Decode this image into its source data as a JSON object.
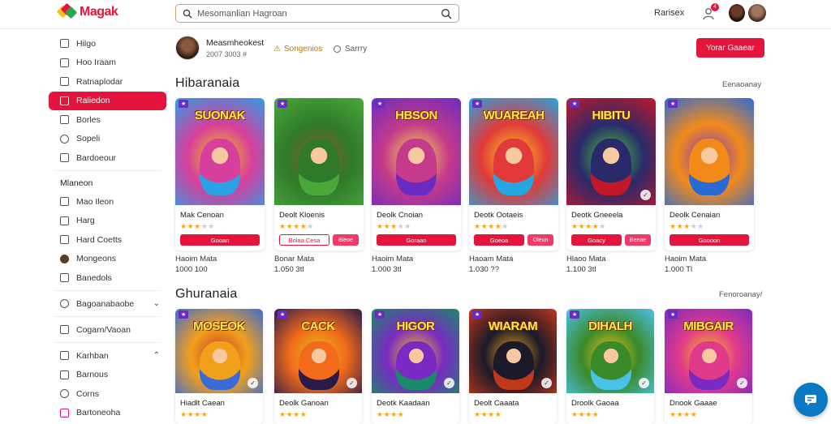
{
  "app": {
    "logo_text": "Magak"
  },
  "search": {
    "placeholder": "Mesomanlian Hagroan"
  },
  "header": {
    "right_label": "Rarisex",
    "notification_count": "4"
  },
  "profile": {
    "name": "Measmheokest",
    "sub": "2007 3003 #"
  },
  "badges": {
    "gold": "Songenios",
    "gray": "Sarrry"
  },
  "cta": {
    "label": "Yorar Gaaear"
  },
  "sidebar": {
    "items_top": [
      {
        "label": "Hilgo"
      },
      {
        "label": "Hoo Iraam"
      },
      {
        "label": "Ratnaplodar"
      },
      {
        "label": "Raliedon",
        "active": true
      },
      {
        "label": "Borles"
      },
      {
        "label": "Sopeli"
      },
      {
        "label": "Bardoeour"
      }
    ],
    "section_label": "Mlaneon",
    "items_mid": [
      {
        "label": "Mao Ileon"
      },
      {
        "label": "Harg"
      },
      {
        "label": "Hard Coetts"
      },
      {
        "label": "Mongeons"
      },
      {
        "label": "Banedols"
      }
    ],
    "items_bottom": [
      {
        "label": "Bagoanabaobe"
      },
      {
        "label": "Cogarn/Vaoan"
      },
      {
        "label": "Karhban"
      },
      {
        "label": "Barnous"
      },
      {
        "label": "Corns"
      },
      {
        "label": "Bartoneoha"
      }
    ]
  },
  "sections": [
    {
      "title": "Hibaranaia",
      "link": "Eenaoanay",
      "cards": [
        {
          "art_title": "SUONAK",
          "title": "Mak Cenoan",
          "rating": 3,
          "btn": "Gooan",
          "btn2": "",
          "stat1": "Haoim Mata",
          "stat2": "1000 100"
        },
        {
          "art_title": "",
          "title": "Deolt Kloenis",
          "rating": 4,
          "btn": "Bolaa Cesa",
          "btn2": "Bleoe",
          "stat1": "Bonar Mata",
          "stat2": "1.050 3tl"
        },
        {
          "art_title": "HBSON",
          "title": "Deolk Cnoian",
          "rating": 3,
          "btn": "Goraan",
          "btn2": "",
          "stat1": "Haoim Mata",
          "stat2": "1.000 3tl"
        },
        {
          "art_title": "WUAREAH",
          "title": "Deotk Ootaeis",
          "rating": 4,
          "btn": "Goeoa",
          "btn2": "Oleun",
          "stat1": "Haoam Mata",
          "stat2": "1.030 ??"
        },
        {
          "art_title": "HIBITU",
          "title": "Deotk Gneeela",
          "rating": 4,
          "btn": "Goacy",
          "btn2": "Beeae",
          "stat1": "Hlaoo Mata",
          "stat2": "1.100 3tl"
        },
        {
          "art_title": "",
          "title": "Deolk Cenaian",
          "rating": 3,
          "btn": "Goooon",
          "btn2": "",
          "stat1": "Haoim Mata",
          "stat2": "1.000 Tl"
        }
      ]
    },
    {
      "title": "Ghuranaia",
      "link": "Fenoroanay/",
      "cards": [
        {
          "art_title": "MOSEOK",
          "title": "Hiadlt Caean"
        },
        {
          "art_title": "CACK",
          "title": "Deolk Ganoan"
        },
        {
          "art_title": "HIGOR",
          "title": "Deotk Kaadaan"
        },
        {
          "art_title": "WIARAM",
          "title": "Deolt Caaata"
        },
        {
          "art_title": "DIHALH",
          "title": "Droolk Gaoaa"
        },
        {
          "art_title": "MIBGAIR",
          "title": "Dnook Gaaae"
        }
      ]
    }
  ],
  "colors": {
    "accent": "#e4143c",
    "fab": "#0a78c2",
    "star": "#f4a623"
  }
}
